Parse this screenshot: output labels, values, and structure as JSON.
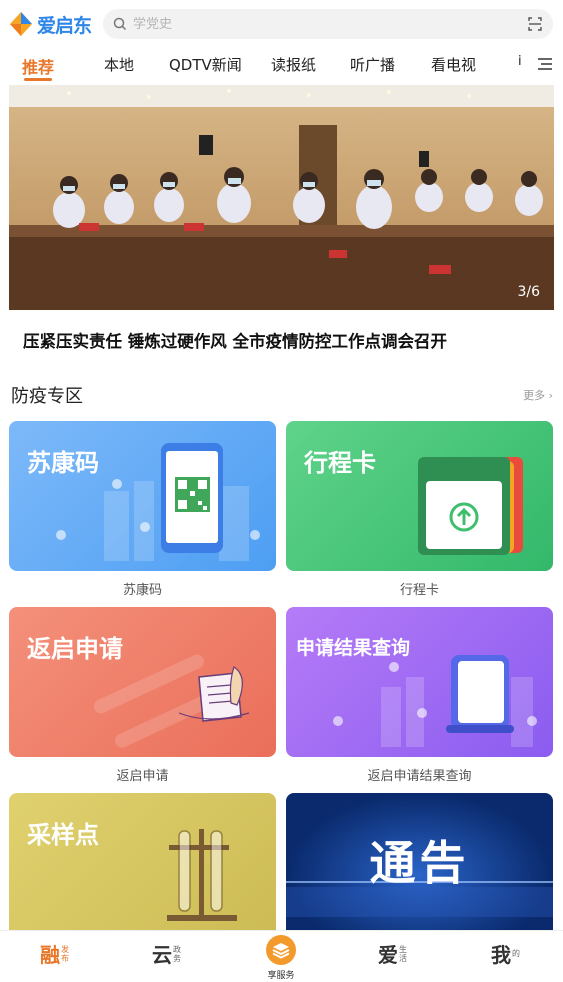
{
  "app": {
    "logo_text": "爱启东"
  },
  "search": {
    "placeholder": "学党史"
  },
  "tabs": [
    {
      "label": "推荐",
      "active": true
    },
    {
      "label": "本地"
    },
    {
      "label": "QDTV新闻"
    },
    {
      "label": "读报纸"
    },
    {
      "label": "听广播"
    },
    {
      "label": "看电视"
    },
    {
      "label": "i"
    }
  ],
  "banner": {
    "counter": "3/6",
    "headline": "压紧压实责任 锤炼过硬作风 全市疫情防控工作点调会召开"
  },
  "section": {
    "title": "防疫专区",
    "more": "更多"
  },
  "cards": [
    {
      "title": "苏康码",
      "label": "苏康码",
      "color": "#5aa9f7"
    },
    {
      "title": "行程卡",
      "label": "行程卡",
      "color": "#3fbe6d"
    },
    {
      "title": "返启申请",
      "label": "返启申请",
      "color": "#ef7c64"
    },
    {
      "title": "申请结果查询",
      "label": "返启申请结果查询",
      "color": "#9a66f2"
    },
    {
      "title": "采样点",
      "label": "",
      "color": "#d6c562"
    },
    {
      "title": "通告",
      "label": "",
      "color": "#0e3a8a"
    }
  ],
  "bottom_nav": [
    {
      "big": "融",
      "small": "发布",
      "active": true
    },
    {
      "big": "云",
      "small": "政务"
    },
    {
      "label": "享服务"
    },
    {
      "big": "爱",
      "small": "生活"
    },
    {
      "big": "我",
      "small": "的"
    }
  ],
  "colors": {
    "accent": "#e8772a",
    "brand": "#2e86e8"
  }
}
